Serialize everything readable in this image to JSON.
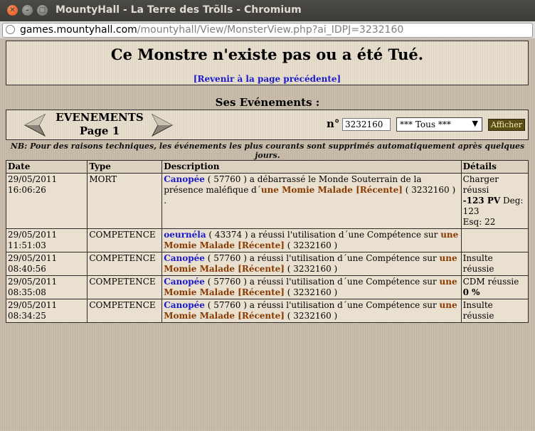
{
  "window": {
    "title": "MountyHall - La Terre des Trõlls - Chromium",
    "url_host": "games.mountyhall.com",
    "url_path": "/mountyhall/View/MonsterView.php?ai_IDPJ=3232160"
  },
  "header": {
    "title": "Ce Monstre n'existe pas ou a été Tué.",
    "back_link": "[Revenir à la page précédente]"
  },
  "events_section": {
    "title": "Ses Evénements :",
    "label_line1": "EVENEMENTS",
    "label_line2": "Page 1",
    "number_label": "n°",
    "number_value": "3232160",
    "filter_selected": "*** Tous ***",
    "submit_label": "Afficher",
    "note": "NB: Pour des raisons techniques, les événements les plus courants sont supprimés automatiquement après quelques jours."
  },
  "table": {
    "headers": [
      "Date",
      "Type",
      "Description",
      "Détails"
    ],
    "rows": [
      {
        "date": "29/05/2011 16:06:26",
        "type": "MORT",
        "actor": "Canopée",
        "actor_id": " ( 57760 ) ",
        "action": "a débarrassé le Monde Souterrain de la présence maléfique d´",
        "target": "une Momie Malade [Récente]",
        "target_id": " ( 3232160 ) .",
        "detail_l1": "Charger réussi",
        "detail_l2_bold": "-123 PV",
        "detail_l2_rest": " Deg: 123",
        "detail_l3": "Esq: 22"
      },
      {
        "date": "29/05/2011 11:51:03",
        "type": "COMPETENCE",
        "actor": "oeurnéla",
        "actor_id": " ( 43374 ) ",
        "action": "a réussi l'utilisation d´une Compétence sur ",
        "target": "une Momie Malade [Récente]",
        "target_id": " ( 3232160 )",
        "detail_l1": "",
        "detail_l2": ""
      },
      {
        "date": "29/05/2011 08:40:56",
        "type": "COMPETENCE",
        "actor": "Canopée",
        "actor_id": " ( 57760 ) ",
        "action": "a réussi l'utilisation d´une Compétence sur ",
        "target": "une Momie Malade [Récente]",
        "target_id": " ( 3232160 )",
        "detail_l1": "Insulte réussie",
        "detail_l2": ""
      },
      {
        "date": "29/05/2011 08:35:08",
        "type": "COMPETENCE",
        "actor": "Canopée",
        "actor_id": " ( 57760 ) ",
        "action": "a réussi l'utilisation d´une Compétence sur ",
        "target": "une Momie Malade [Récente]",
        "target_id": " ( 3232160 )",
        "detail_l1": "CDM réussie",
        "detail_l2": "0 %"
      },
      {
        "date": "29/05/2011 08:34:25",
        "type": "COMPETENCE",
        "actor": "Canopée",
        "actor_id": " ( 57760 ) ",
        "action": "a réussi l'utilisation d´une Compétence sur ",
        "target": "une Momie Malade [Récente]",
        "target_id": " ( 3232160 )",
        "detail_l1": "Insulte réussie",
        "detail_l2": ""
      }
    ]
  },
  "colors": {
    "link": "#1a1acc",
    "monster": "#8a3a00",
    "button_bg": "#5b4e14"
  }
}
